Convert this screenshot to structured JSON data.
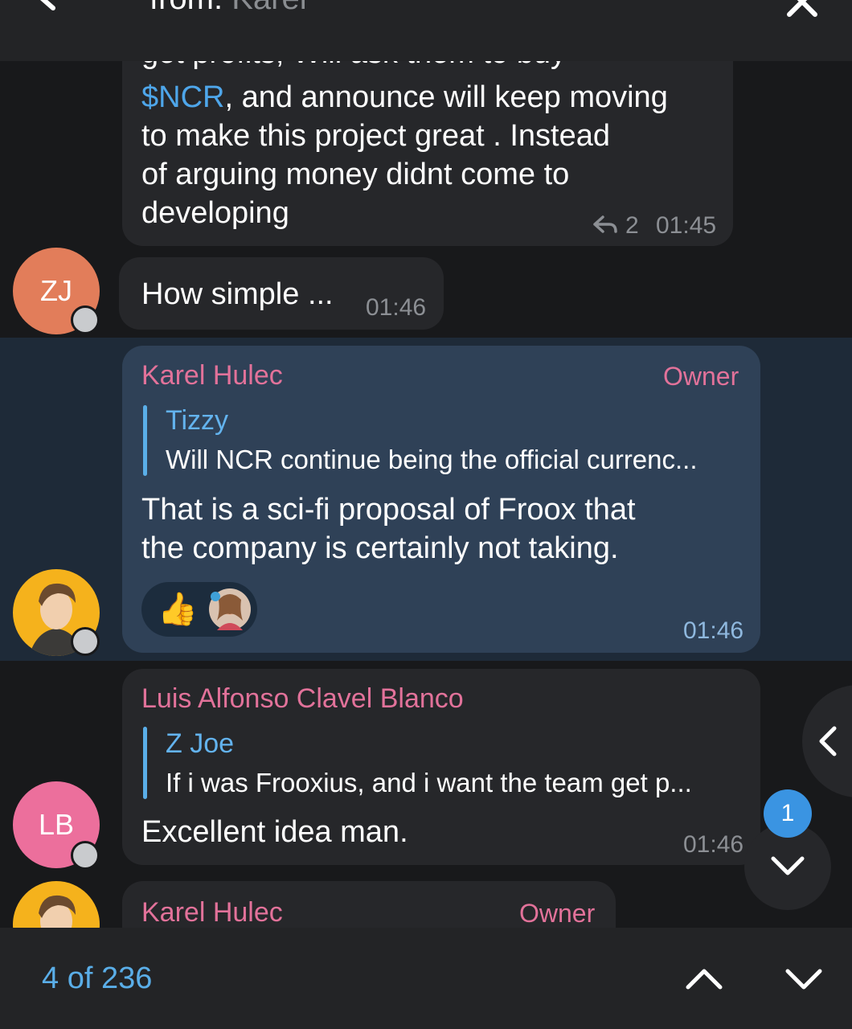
{
  "search": {
    "prefix": "from:",
    "query": "Karel"
  },
  "messages": [
    {
      "partial_top_line": "get profits,  Will ask them to buy",
      "link_text": "$NCR",
      "line1_rest": ",  and announce will keep moving",
      "line2": "to make this project great .  Instead",
      "line3": "of arguing money didnt come to",
      "line4": "developing",
      "reply_count": "2",
      "time": "01:45"
    },
    {
      "avatar_initials": "ZJ",
      "avatar_color": "#e27d5a",
      "text": "How simple ...",
      "time": "01:46"
    },
    {
      "sender": "Karel Hulec",
      "role": "Owner",
      "quote_author": "Tizzy",
      "quote_text": "Will NCR continue being the official currenc...",
      "line1": "That is a sci-fi proposal of Froox that",
      "line2": "the company is certainly not taking.",
      "reaction_emoji": "👍",
      "time": "01:46"
    },
    {
      "avatar_initials": "LB",
      "avatar_color": "#ec6f9c",
      "sender": "Luis Alfonso Clavel Blanco",
      "quote_author": "Z Joe",
      "quote_text": "If i was Frooxius,  and i want the team get p...",
      "text": "Excellent idea man.",
      "time": "01:46"
    },
    {
      "sender": "Karel Hulec",
      "role": "Owner"
    }
  ],
  "unread_badge": "1",
  "footer": {
    "result_counter": "4 of 236"
  },
  "colors": {
    "accent": "#5aaee8",
    "sender_name": "#e2729a",
    "highlight_bubble": "#2f4157"
  }
}
